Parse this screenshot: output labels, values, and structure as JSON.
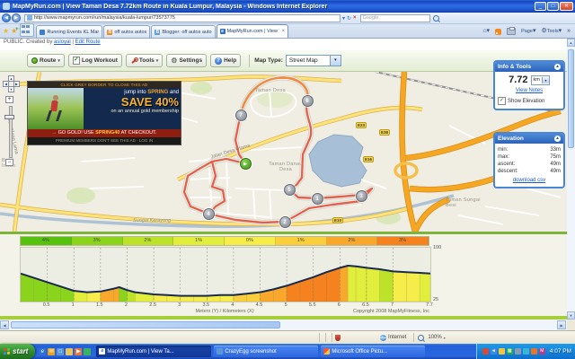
{
  "window": {
    "title": "MapMyRun.com | View Taman Desa 7.72km Route in Kuala Lumpur, Malaysia - Windows Internet Explorer",
    "buttons": [
      "minimize",
      "maximize",
      "close"
    ]
  },
  "browser": {
    "url": "http://www.mapmyrun.com/run/malaysia/kuala-lumpur/73573775",
    "search_placeholder": "Google",
    "tabs": [
      {
        "label": "Running Events KL Mara",
        "active": false
      },
      {
        "label": "off autos autos",
        "active": false
      },
      {
        "label": "Blogger: off autos auto",
        "active": false
      },
      {
        "label": "MapMyRun.com | View Ta",
        "active": true
      }
    ],
    "toolbar_right": {
      "page_label": "Page",
      "tools_label": "Tools",
      "overflow": "»"
    }
  },
  "page": {
    "meta_line": {
      "prefix": "PUBLIC. Created by",
      "user": "asloyal",
      "sep": "|",
      "edit_link": "Edit Route"
    },
    "map_toolbar": {
      "route": "Route",
      "log_workout": "Log Workout",
      "tools": "Tools",
      "settings": "Settings",
      "help": "Help",
      "map_type_label": "Map Type:",
      "map_type_value": "Street Map"
    },
    "info_panel": {
      "title": "Info & Tools",
      "distance": "7.72",
      "unit": "km",
      "view_notes": "View Notes",
      "show_elevation": "Show Elevation"
    },
    "elevation_panel": {
      "title": "Elevation",
      "rows": [
        {
          "label": "min:",
          "value": "33m"
        },
        {
          "label": "max:",
          "value": "75m"
        },
        {
          "label": "ascent:",
          "value": "49m"
        },
        {
          "label": "descent:",
          "value": "49m"
        }
      ],
      "download": "download csv"
    },
    "map": {
      "labels": [
        {
          "text": "Taman Desa"
        },
        {
          "text": "Taman Danau Desa"
        },
        {
          "text": "Bukit Indah"
        },
        {
          "text": "Sungai Kerayong"
        },
        {
          "text": "Jalan Desa Utama"
        },
        {
          "text": "Jalan Klang Lama"
        },
        {
          "text": "Taman Sungai Besi"
        }
      ],
      "shields": [
        {
          "text": "E23"
        },
        {
          "text": "E38"
        },
        {
          "text": "E16"
        },
        {
          "text": "E10"
        }
      ],
      "markers": [
        "1",
        "2",
        "3",
        "4",
        "5",
        "6",
        "7"
      ],
      "start_glyph": "▶"
    },
    "ad": {
      "top": "CLICK GREY BORDER TO CLOSE THIS AD",
      "line1_a": "jump into ",
      "line1_b": "SPRING",
      "line1_c": " and",
      "line2": "SAVE 40%",
      "line3": "on an annual gold membership",
      "cta_arrow": "→ ",
      "cta_pre": "GO GOLD! USE ",
      "cta_code": "SPRING40",
      "cta_post": " AT CHECKOUT.",
      "bottom": "PREMIUM MEMBERS DON'T SEE THIS AD · LOG IN"
    }
  },
  "chart_data": {
    "type": "area",
    "title": "Route elevation profile",
    "xlabel": "Meters (Y) / Kilometers (X)",
    "ylabel": "",
    "x": [
      0,
      0.25,
      0.5,
      0.75,
      1,
      1.25,
      1.5,
      1.75,
      1.85,
      2,
      2.15,
      2.5,
      2.75,
      3,
      3.25,
      3.5,
      3.75,
      4,
      4.25,
      4.5,
      4.75,
      5,
      5.25,
      5.5,
      5.75,
      6,
      6.15,
      6.3,
      6.5,
      6.75,
      7,
      7.25,
      7.5,
      7.7
    ],
    "elevation_m": [
      64,
      58,
      52,
      46,
      40,
      38,
      39,
      43,
      45,
      41,
      38,
      35,
      34,
      33,
      33,
      33,
      34,
      34,
      36,
      38,
      42,
      47,
      53,
      59,
      66,
      72,
      75,
      74,
      72,
      70,
      67,
      66,
      65,
      64
    ],
    "ylim": [
      25,
      100
    ],
    "xticks": [
      0.5,
      1,
      1.5,
      2,
      2.5,
      3,
      3.5,
      4,
      4.5,
      5,
      5.5,
      6,
      6.5,
      7,
      7.7
    ],
    "grid": true,
    "legend_position": "top",
    "grades": [
      {
        "label": "4%",
        "color": "#55C20E"
      },
      {
        "label": "3%",
        "color": "#8BD41C"
      },
      {
        "label": "2%",
        "color": "#BCE32A"
      },
      {
        "label": "1%",
        "color": "#E2EE3C"
      },
      {
        "label": "0%",
        "color": "#F7ED4A"
      },
      {
        "label": "1%",
        "color": "#FBCE3B"
      },
      {
        "label": "2%",
        "color": "#F9A82C"
      },
      {
        "label": "3%",
        "color": "#F5811F"
      }
    ],
    "copyright": "Copyright 2008 MapMyFitness, Inc"
  },
  "status_bar": {
    "zone_label": "Internet",
    "zoom_label": "100%"
  },
  "taskbar": {
    "start_label": "start",
    "quick_launch": [
      "internet-explorer",
      "outlook",
      "show-desktop",
      "folder",
      "media-player",
      "messenger"
    ],
    "windows": [
      {
        "label": "MapMyRun.com | View Ta...",
        "active": true
      },
      {
        "label": "CrazyEgg screenshot",
        "active": false
      },
      {
        "label": "Microsoft Office Pictu...",
        "active": false
      }
    ],
    "tray": [
      "security",
      "volume",
      "network",
      "updates",
      "display",
      "messenger",
      "battery",
      "antivirus"
    ],
    "clock": "4:07 PM"
  }
}
